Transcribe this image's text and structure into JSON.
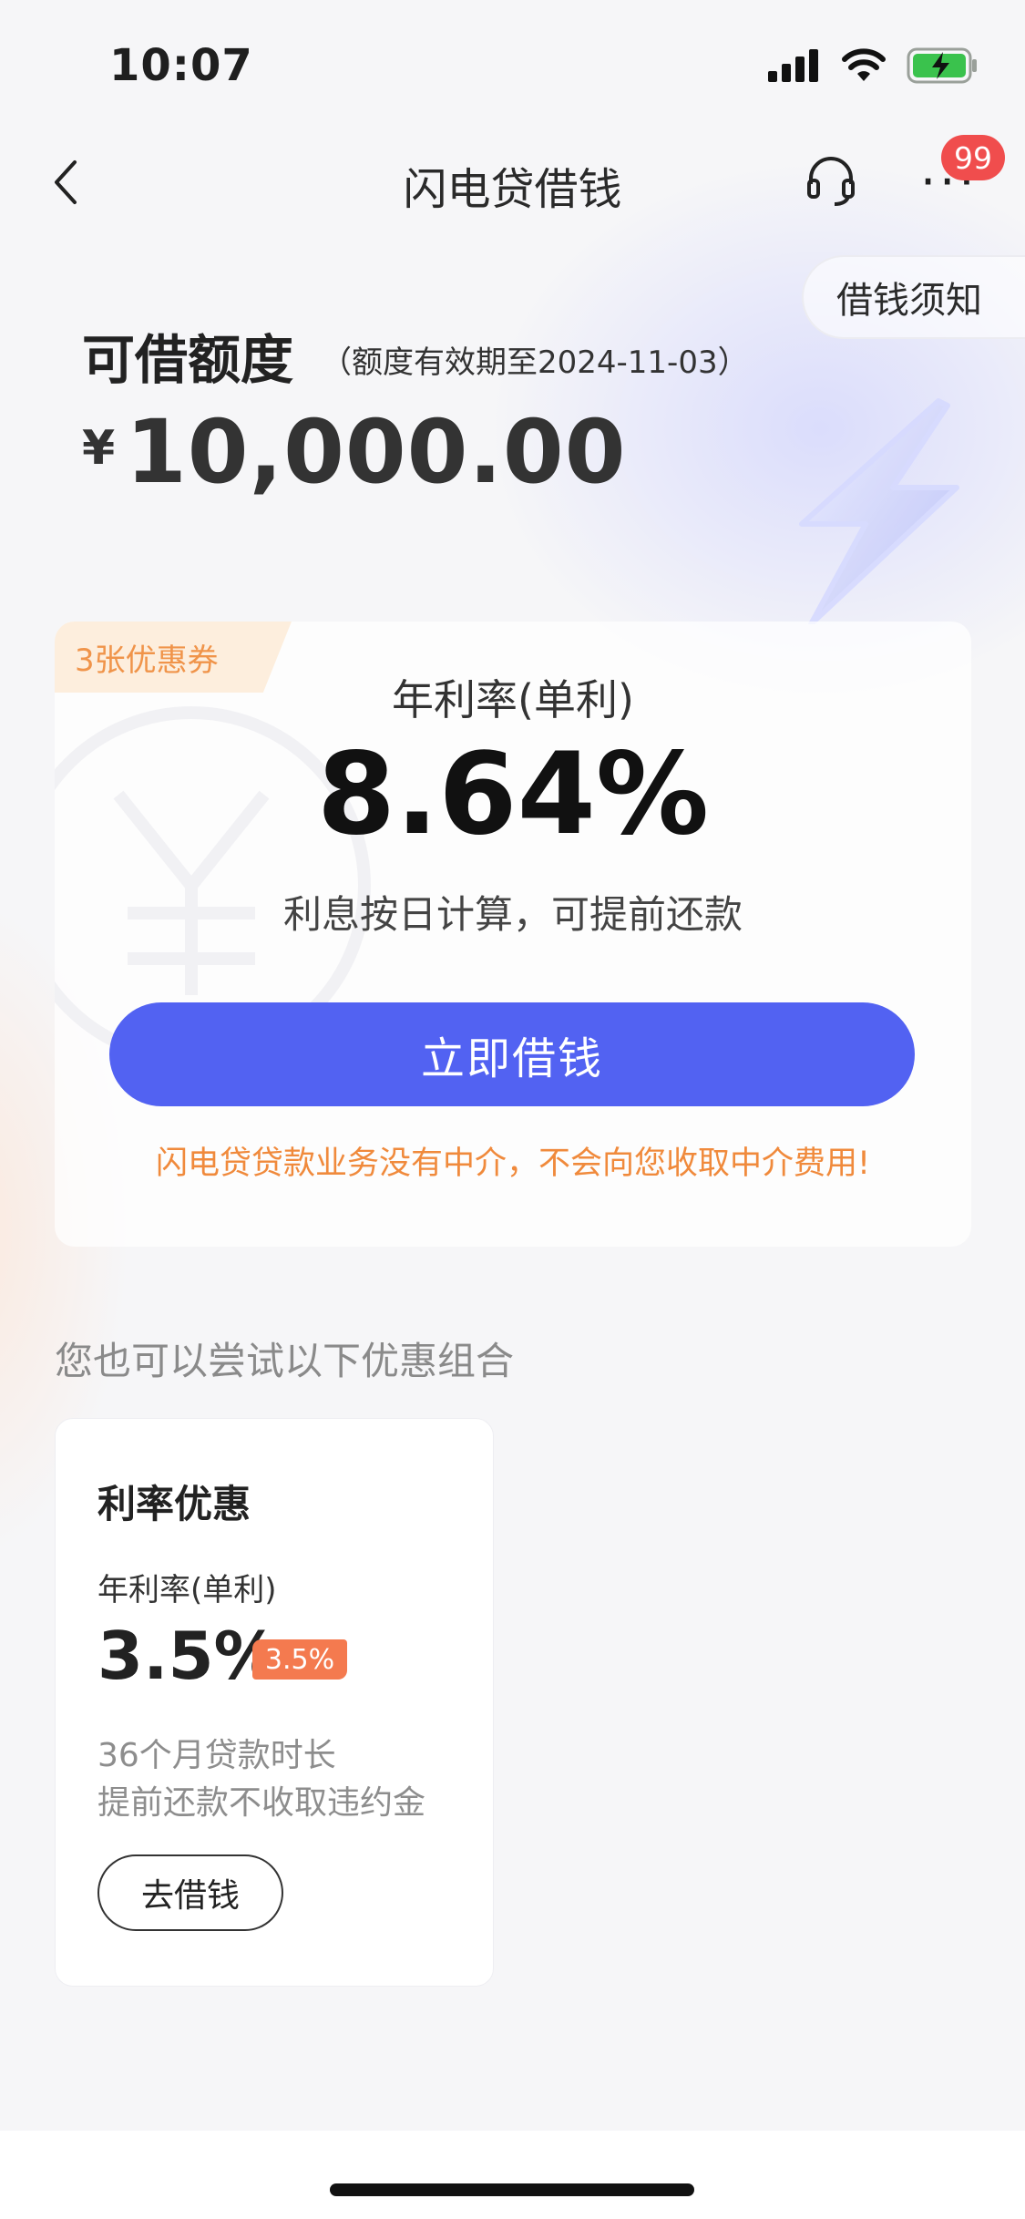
{
  "status_bar": {
    "time": "10:07"
  },
  "nav": {
    "title": "闪电贷借钱",
    "badge_count": "99"
  },
  "notice": {
    "label": "借钱须知"
  },
  "credit": {
    "label": "可借额度",
    "validity_note": "（额度有效期至2024-11-03）",
    "currency_symbol": "¥",
    "amount": "10,000.00"
  },
  "main_card": {
    "coupon_tag": "3张优惠券",
    "rate_label": "年利率(单利)",
    "rate_value": "8.64%",
    "rate_sub": "利息按日计算，可提前还款",
    "borrow_button": "立即借钱",
    "warning": "闪电贷贷款业务没有中介，不会向您收取中介费用!"
  },
  "section": {
    "title": "您也可以尝试以下优惠组合"
  },
  "promo": {
    "title": "利率优惠",
    "rate_label": "年利率(单利)",
    "rate_value": "3.5%",
    "rate_tag": "3.5%",
    "line1": "36个月贷款时长",
    "line2": "提前还款不收取违约金",
    "button": "去借钱"
  },
  "colors": {
    "primary": "#5262f2",
    "warning": "#f08a3c",
    "badge": "#f04d4d",
    "coupon_bg": "#fdeedd",
    "promo_tag": "#f47a4f"
  },
  "icons": [
    "back-chevron-icon",
    "headset-icon",
    "more-dots-icon",
    "signal-icon",
    "wifi-icon",
    "battery-charging-icon",
    "lightning-bolt-icon"
  ]
}
